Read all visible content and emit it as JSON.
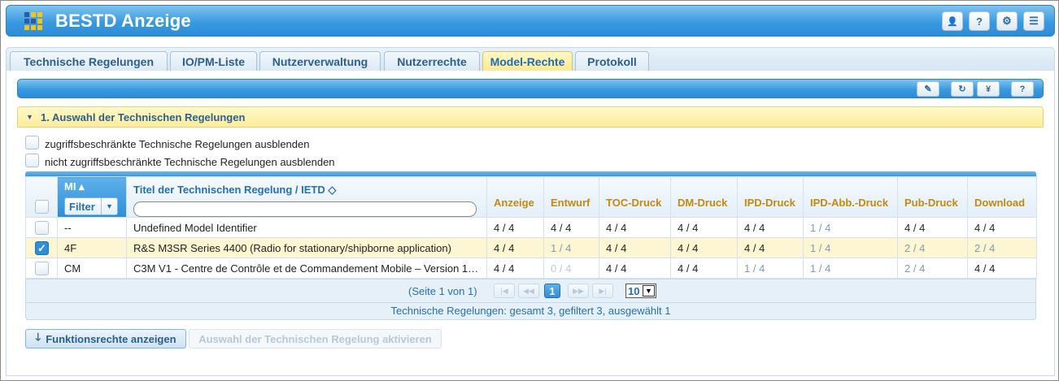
{
  "app": {
    "title": "BESTD Anzeige"
  },
  "header_buttons": [
    {
      "icon": "user-icon",
      "glyph": "👤"
    },
    {
      "icon": "help-icon",
      "glyph": "?"
    },
    {
      "icon": "gear-icon",
      "glyph": "⚙"
    },
    {
      "icon": "menu-icon",
      "glyph": "☰"
    }
  ],
  "tabs": [
    {
      "label": "Technische Regelungen",
      "active": false
    },
    {
      "label": "IO/PM-Liste",
      "active": false
    },
    {
      "label": "Nutzerverwaltung",
      "active": false
    },
    {
      "label": "Nutzerrechte",
      "active": false
    },
    {
      "label": "Model-Rechte",
      "active": true
    },
    {
      "label": "Protokoll",
      "active": false
    }
  ],
  "toolbar_buttons": [
    {
      "icon": "edit-icon",
      "glyph": "✎"
    },
    {
      "icon": "refresh-icon",
      "glyph": "↻"
    },
    {
      "icon": "yen-icon",
      "glyph": "¥"
    },
    {
      "icon": "help-icon",
      "glyph": "?"
    }
  ],
  "section": {
    "title": "1. Auswahl der Technischen Regelungen"
  },
  "filters": [
    {
      "label": "zugriffsbeschränkte Technische Regelungen ausblenden",
      "checked": false
    },
    {
      "label": "nicht zugriffsbeschränkte Technische Regelungen ausblenden",
      "checked": false
    }
  ],
  "table": {
    "mi_header": "MI ▴",
    "filter_label": "Filter",
    "title_header": "Titel der Technischen Regelung / IETD ◇",
    "columns": [
      "Anzeige",
      "Entwurf",
      "TOC-Druck",
      "DM-Druck",
      "IPD-Druck",
      "IPD-Abb.-Druck",
      "Pub-Druck",
      "Download"
    ],
    "rows": [
      {
        "checked": false,
        "mi": "--",
        "title": "Undefined Model Identifier",
        "values": [
          "4 / 4",
          "4 / 4",
          "4 / 4",
          "4 / 4",
          "4 / 4",
          "1 / 4",
          "4 / 4",
          "4 / 4"
        ],
        "styles": [
          "",
          "",
          "",
          "",
          "",
          "dim",
          "",
          ""
        ]
      },
      {
        "checked": true,
        "mi": "4F",
        "title": "R&S M3SR Series 4400 (Radio for stationary/shipborne application)",
        "values": [
          "4 / 4",
          "1 / 4",
          "4 / 4",
          "4 / 4",
          "4 / 4",
          "1 / 4",
          "2 / 4",
          "2 / 4"
        ],
        "styles": [
          "",
          "dim",
          "",
          "",
          "",
          "dim",
          "dim",
          "dim"
        ]
      },
      {
        "checked": false,
        "mi": "CM",
        "title": "C3M V1 - Centre de Contrôle et de Commandement Mobile – Version 1…",
        "values": [
          "4 / 4",
          "0 / 4",
          "4 / 4",
          "4 / 4",
          "1 / 4",
          "1 / 4",
          "2 / 4",
          "4 / 4"
        ],
        "styles": [
          "",
          "dimmer",
          "",
          "",
          "dim",
          "dim",
          "dim",
          ""
        ]
      }
    ]
  },
  "pager": {
    "text": "(Seite 1 von 1)",
    "current_page": "1",
    "page_size": "10"
  },
  "summary": "Technische Regelungen: gesamt 3, gefiltert 3, ausgewählt 1",
  "actions": {
    "show_rights": "Funktionsrechte anzeigen",
    "activate": "Auswahl der Technischen Regelung aktivieren"
  }
}
